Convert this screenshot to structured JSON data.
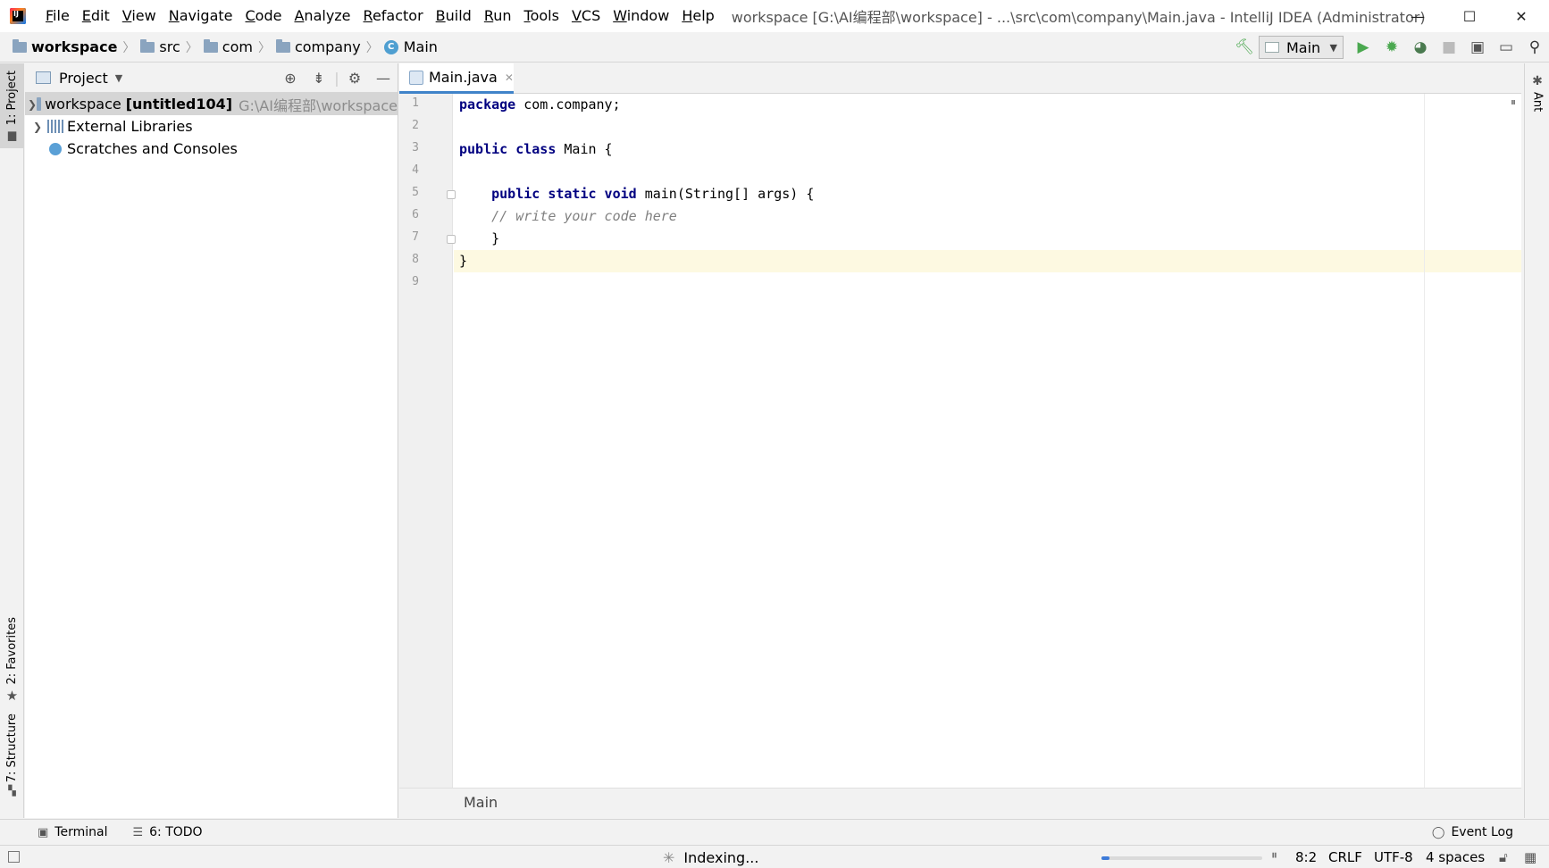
{
  "titlebar": {
    "menu": [
      "File",
      "Edit",
      "View",
      "Navigate",
      "Code",
      "Analyze",
      "Refactor",
      "Build",
      "Run",
      "Tools",
      "VCS",
      "Window",
      "Help"
    ],
    "window_title": "workspace [G:\\AI编程部\\workspace] - ...\\src\\com\\company\\Main.java - IntelliJ IDEA (Administrator)",
    "minimize": "—",
    "maximize": "☐",
    "close": "✕"
  },
  "navbar": {
    "crumbs": [
      "workspace",
      "src",
      "com",
      "company"
    ],
    "class_name": "Main",
    "class_icon_letter": "C",
    "run_config": "Main"
  },
  "left_strip": {
    "project_tab": "1: Project",
    "favorites_tab": "2: Favorites",
    "structure_tab": "7: Structure"
  },
  "project": {
    "title": "Project",
    "tree": [
      {
        "label": "workspace",
        "suffix": "[untitled104]",
        "path": "G:\\AI编程部\\workspace"
      },
      {
        "label": "External Libraries"
      },
      {
        "label": "Scratches and Consoles"
      }
    ]
  },
  "editor": {
    "tab_name": "Main.java",
    "line_numbers": [
      "1",
      "2",
      "3",
      "4",
      "5",
      "6",
      "7",
      "8",
      "9"
    ],
    "code": {
      "l1_kw": "package",
      "l1_rest": " com.company;",
      "l3_kw": "public class",
      "l3_rest": " Main {",
      "l5_indent": "    ",
      "l5_kw": "public static void",
      "l5_rest": " main(String[] args) {",
      "l6": "    // write your code here",
      "l7": "    }",
      "l8": "}"
    },
    "breadcrumb": "Main"
  },
  "right_strip": {
    "ant_tab": "Ant"
  },
  "toolwindows": {
    "terminal": "Terminal",
    "todo": "6: TODO",
    "event_log": "Event Log"
  },
  "status": {
    "indexing": "Indexing...",
    "progress": 0.05,
    "position": "8:2",
    "line_sep": "CRLF",
    "encoding": "UTF-8",
    "indent": "4 spaces"
  },
  "colors": {
    "keyword": "#000080",
    "comment": "#808080",
    "current_line": "#fdf9e1",
    "tab_underline": "#4083c9",
    "run_green": "#4aa84f"
  }
}
